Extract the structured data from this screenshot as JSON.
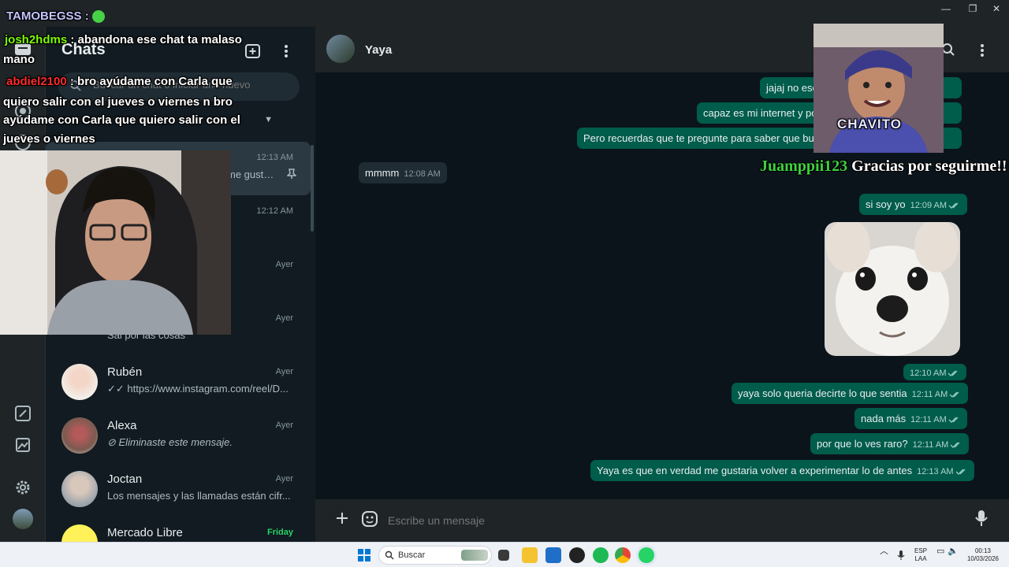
{
  "window": {
    "minimize": "—",
    "maximize": "❐",
    "close": "✕"
  },
  "chatlist": {
    "title": "Chats",
    "search_placeholder": "Buscar un chat o iniciar uno nuevo",
    "items": [
      {
        "name": "",
        "preview": "me gusta...",
        "time": "12:13 AM"
      },
      {
        "name": "",
        "preview": "",
        "time": "12:12 AM"
      },
      {
        "name": "",
        "preview": "",
        "time": "Ayer"
      },
      {
        "name": "",
        "preview": "Sal por las cosas",
        "time": "Ayer"
      },
      {
        "name": "Rubén",
        "preview": "https://www.instagram.com/reel/D...",
        "time": "Ayer"
      },
      {
        "name": "Alexa",
        "preview": "Eliminaste este mensaje.",
        "time": "Ayer"
      },
      {
        "name": "Joctan",
        "preview": "Los mensajes y las llamadas están cifr...",
        "time": "Ayer"
      },
      {
        "name": "Mercado Libre",
        "preview": "",
        "time": "Friday"
      }
    ]
  },
  "conversation": {
    "contact": "Yaya",
    "messages": [
      {
        "text": "jajaj no esc",
        "time": "",
        "dir": "out"
      },
      {
        "text": "capaz es mi internet y po",
        "time": "",
        "dir": "out"
      },
      {
        "text": "Pero recuerdas que te pregunte para saber que bus",
        "time": "",
        "dir": "out"
      },
      {
        "text": "mmmm",
        "time": "12:08 AM",
        "dir": "in"
      },
      {
        "text": "si soy yo",
        "time": "12:09 AM",
        "dir": "out"
      },
      {
        "text": "",
        "time": "12:10 AM",
        "dir": "out"
      },
      {
        "text": "yaya solo queria decirte lo que sentia",
        "time": "12:11 AM",
        "dir": "out"
      },
      {
        "text": "nada más",
        "time": "12:11 AM",
        "dir": "out"
      },
      {
        "text": "por que lo ves raro?",
        "time": "12:11 AM",
        "dir": "out"
      },
      {
        "text": "Yaya es que en verdad me gustaria volver a experimentar lo de antes",
        "time": "12:13 AM",
        "dir": "out"
      }
    ],
    "composer_placeholder": "Escribe un mensaje"
  },
  "overlay": {
    "chat_lines": [
      {
        "user": "TAMOBEGSS",
        "text": ""
      },
      {
        "user": "josh2hdms",
        "text": ": abandona ese chat ta malaso"
      },
      {
        "user": "",
        "text": "mano"
      },
      {
        "user": "abdiel2100",
        "text": ": bro ayúdame con Carla que"
      },
      {
        "user": "",
        "text": "quiero salir con el jueves o viernes n bro"
      },
      {
        "user": "",
        "text": "ayúdame con Carla que quiero salir con el"
      },
      {
        "user": "",
        "text": "jueves o viernes"
      }
    ],
    "alert_caption": "CHAVITO",
    "alert_user": "Juamppii123",
    "alert_message": "Gracias por seguirme!!"
  },
  "taskbar": {
    "search_label": "Buscar",
    "lang_line1": "ESP",
    "lang_line2": "LAA",
    "time": "00:13",
    "date": "10/03/2026"
  },
  "colors": {
    "outgoing_bubble": "#005c4b",
    "incoming_bubble": "#202c33",
    "background": "#0b141a",
    "accent_green": "#25d366"
  }
}
